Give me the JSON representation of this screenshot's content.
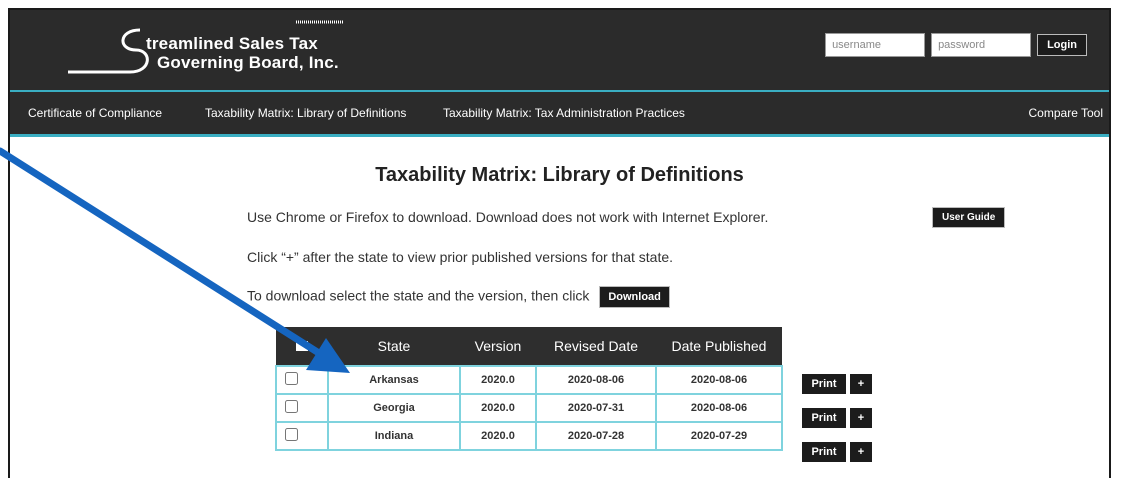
{
  "brand": {
    "line1": "treamlined Sales Tax",
    "line2": "Governing Board, Inc.",
    "initial": "S"
  },
  "auth": {
    "username_placeholder": "username",
    "password_placeholder": "password",
    "login_label": "Login"
  },
  "nav": {
    "items": [
      {
        "label": "Certificate of Compliance"
      },
      {
        "label": "Taxability Matrix: Library of Definitions"
      },
      {
        "label": "Taxability Matrix: Tax Administration Practices"
      }
    ],
    "compare_tool": "Compare Tool"
  },
  "main": {
    "title": "Taxability Matrix: Library of Definitions",
    "browser_note": "Use Chrome or Firefox to download. Download does not work with Internet Explorer.",
    "user_guide_label": "User Guide",
    "plus_note": "Click “+” after the state to view prior published versions for that state.",
    "download_note": "To download select the state and the version, then click",
    "download_label": "Download"
  },
  "table": {
    "headers": [
      "State",
      "Version",
      "Revised Date",
      "Date Published"
    ],
    "rows": [
      {
        "state": "Arkansas",
        "version": "2020.0",
        "revised": "2020-08-06",
        "published": "2020-08-06"
      },
      {
        "state": "Georgia",
        "version": "2020.0",
        "revised": "2020-07-31",
        "published": "2020-08-06"
      },
      {
        "state": "Indiana",
        "version": "2020.0",
        "revised": "2020-07-28",
        "published": "2020-07-29"
      }
    ],
    "print_label": "Print",
    "plus_label": "+"
  },
  "colors": {
    "header_bg": "#2b2b2b",
    "accent": "#3aaec2",
    "table_border": "#7fd3de",
    "arrow": "#1565c0"
  }
}
